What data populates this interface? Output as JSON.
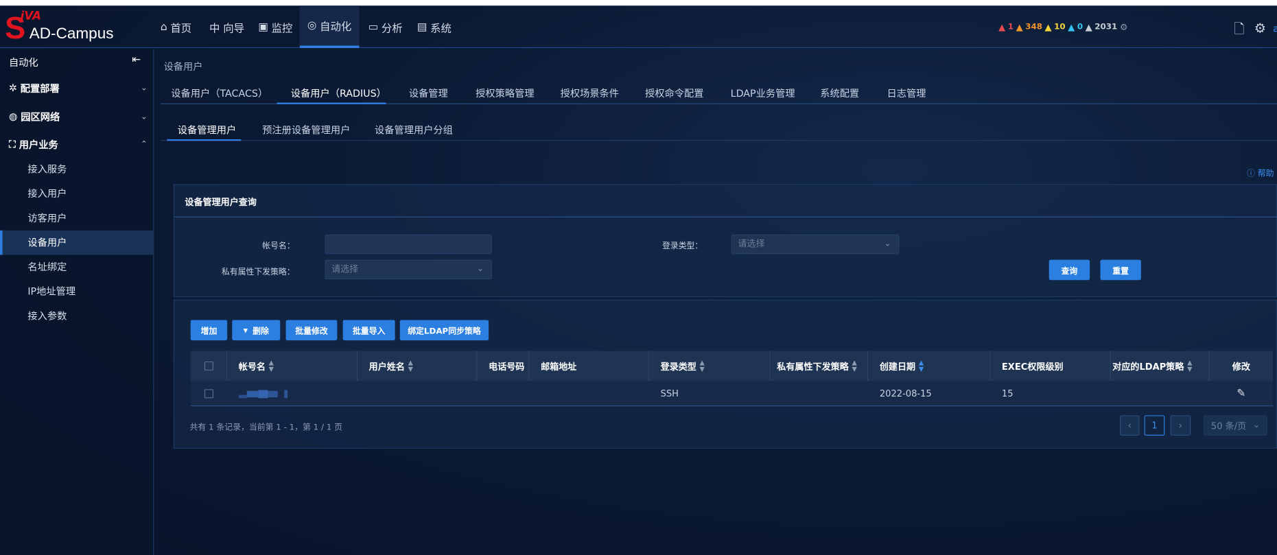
{
  "header": {
    "logo_text": "AD-Campus",
    "logo_mark": "S",
    "logo_small": "iVA",
    "nav": [
      {
        "label": "首页",
        "icon": "home-icon",
        "glyph": "⌂"
      },
      {
        "label": "向导",
        "icon": "guide-icon",
        "glyph": "中"
      },
      {
        "label": "监控",
        "icon": "monitor-icon",
        "glyph": "▣"
      },
      {
        "label": "自动化",
        "icon": "automation-icon",
        "glyph": "◎",
        "active": true
      },
      {
        "label": "分析",
        "icon": "analysis-icon",
        "glyph": "▭"
      },
      {
        "label": "系统",
        "icon": "system-icon",
        "glyph": "▤"
      }
    ],
    "alerts": [
      {
        "count": "1",
        "color": "#e8484f"
      },
      {
        "count": "348",
        "color": "#f0932b"
      },
      {
        "count": "10",
        "color": "#f5d43a"
      },
      {
        "count": "0",
        "color": "#35c3f0"
      },
      {
        "count": "2031",
        "color": "#c8cdd6"
      }
    ],
    "user_initial": "a"
  },
  "sidebar": {
    "title": "自动化",
    "groups": [
      {
        "label": "配置部署",
        "icon": "config-icon",
        "glyph": "✲",
        "chevron": "⌄"
      },
      {
        "label": "园区网络",
        "icon": "globe-icon",
        "glyph": "◍",
        "chevron": "⌄"
      },
      {
        "label": "用户业务",
        "icon": "user-service-icon",
        "glyph": "⛶",
        "chevron": "⌃"
      }
    ],
    "items": [
      {
        "label": "接入服务"
      },
      {
        "label": "接入用户"
      },
      {
        "label": "访客用户"
      },
      {
        "label": "设备用户",
        "active": true
      },
      {
        "label": "名址绑定"
      },
      {
        "label": "IP地址管理"
      },
      {
        "label": "接入参数"
      }
    ]
  },
  "main": {
    "breadcrumb": "设备用户",
    "tabs": [
      "设备用户（TACACS）",
      "设备用户（RADIUS）",
      "设备管理",
      "授权策略管理",
      "授权场景条件",
      "授权命令配置",
      "LDAP业务管理",
      "系统配置",
      "日志管理"
    ],
    "active_tab": 1,
    "subtabs": [
      "设备管理用户",
      "预注册设备管理用户",
      "设备管理用户分组"
    ],
    "help": "帮助",
    "query": {
      "title": "设备管理用户查询",
      "account_label": "帐号名：",
      "account_value": "",
      "login_type_label": "登录类型：",
      "login_type_placeholder": "请选择",
      "private_label": "私有属性下发策略：",
      "private_placeholder": "请选择",
      "search": "查询",
      "reset": "重置"
    },
    "toolbar": {
      "add": "增加",
      "delete": "删除",
      "batch_edit": "批量修改",
      "batch_import": "批量导入",
      "bind_ldap": "绑定LDAP同步策略"
    },
    "table": {
      "columns": [
        "帐号名",
        "用户姓名",
        "电话号码",
        "邮箱地址",
        "登录类型",
        "私有属性下发策略",
        "创建日期",
        "EXEC权限级别",
        "对应的LDAP策略",
        "修改"
      ],
      "rows": [
        {
          "account": "",
          "name": "",
          "phone": "",
          "email": "",
          "login_type": "SSH",
          "private": "",
          "created": "2022-08-15",
          "exec": "15",
          "ldap": ""
        }
      ]
    },
    "footer": {
      "summary": "共有 1 条记录，当前第 1 - 1，第 1 / 1 页",
      "page": "1",
      "prev": "‹",
      "next": "›",
      "page_size": "50 条/页"
    }
  },
  "colors": {
    "accent": "#2a7fe0",
    "header_bg": "#0b1a33"
  }
}
